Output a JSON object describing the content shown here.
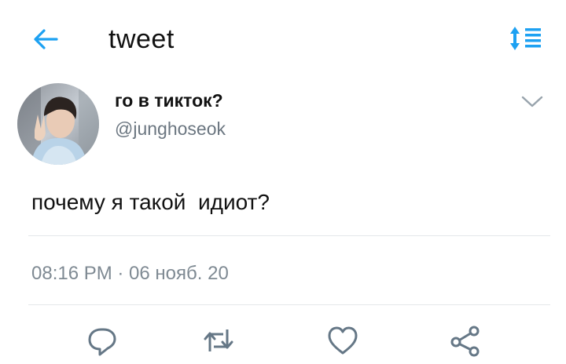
{
  "header": {
    "back_icon": "arrow-left-icon",
    "title": "tweet",
    "sort_icon": "sort-list-icon",
    "accent_color": "#1da1f2"
  },
  "tweet": {
    "display_name": "го в тикток?",
    "handle": "@junghoseok",
    "text": "почему я такой  идиот?",
    "timestamp": "08:16 PM · 06 нояб. 20",
    "menu_icon": "chevron-down-icon"
  },
  "actions": [
    {
      "name": "reply",
      "icon": "reply-bubble-icon"
    },
    {
      "name": "retweet",
      "icon": "retweet-icon"
    },
    {
      "name": "like",
      "icon": "heart-icon"
    },
    {
      "name": "share",
      "icon": "share-icon"
    }
  ],
  "colors": {
    "icon_gray": "#657786",
    "divider": "#e4e7ea",
    "handle_gray": "#6b7680"
  }
}
